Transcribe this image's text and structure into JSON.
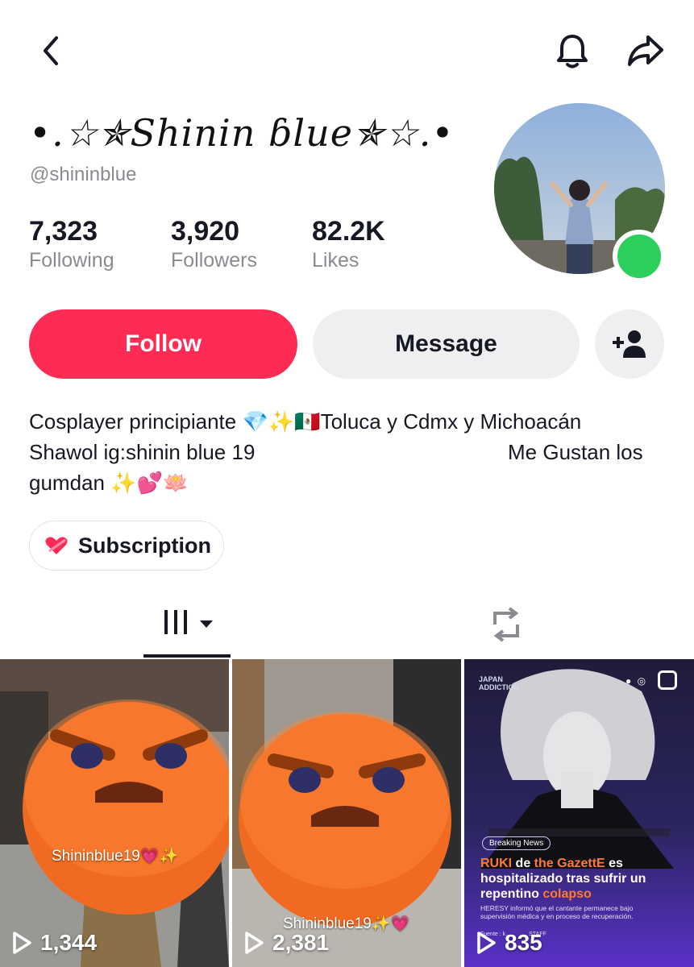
{
  "profile": {
    "display_name": "•.☆✯Shinin ɓlue✯☆.•",
    "handle": "@shininblue",
    "stats": [
      {
        "value": "7,323",
        "label": "Following"
      },
      {
        "value": "3,920",
        "label": "Followers"
      },
      {
        "value": "82.2K",
        "label": "Likes"
      }
    ],
    "online": true
  },
  "actions": {
    "follow_label": "Follow",
    "message_label": "Message"
  },
  "bio": {
    "line1": "Cosplayer principiante 💎✨🇲🇽Toluca y Cdmx y Michoacán",
    "line2_left": "Shawol ig:shinin blue 19",
    "line2_right": "Me Gustan los",
    "line3": "gumdan ✨💕🪷"
  },
  "subscription": {
    "label": "Subscription"
  },
  "colors": {
    "accent": "#fe2c55",
    "online": "#2bcf5b",
    "secondary_text": "#8a8b91"
  },
  "videos": [
    {
      "views": "1,344",
      "watermark": "Shininblue19💗✨"
    },
    {
      "views": "2,381",
      "watermark": "Shininblue19✨💗"
    },
    {
      "views": "835",
      "poster": {
        "brand_line1": "JAPAN",
        "brand_line2": "ADDICTION",
        "badge": "Breaking News",
        "headline_part1": "RUKI",
        "headline_part2": " de ",
        "headline_part3": "the GazettE",
        "headline_part4": " es hospitalizado tras sufrir un repentino ",
        "headline_part5": "colapso",
        "sub": "HERESY informó que el cantante permanece bajo supervisión médica y en proceso de recuperación.",
        "source": "Fuente : k…",
        "staff": "STAFF"
      }
    }
  ]
}
